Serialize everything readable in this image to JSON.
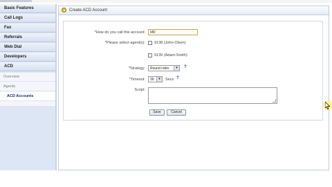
{
  "sidebar": {
    "items": [
      {
        "label": "Basic Features"
      },
      {
        "label": "Call Logs"
      },
      {
        "label": "Fax"
      },
      {
        "label": "Referrals"
      },
      {
        "label": "Web Dial"
      },
      {
        "label": "Developers"
      },
      {
        "label": "ACD"
      }
    ],
    "submenu": [
      {
        "label": "Overview"
      },
      {
        "label": "Agents"
      },
      {
        "label": "ACD Accounts"
      }
    ]
  },
  "panel": {
    "title": "Create ACD Account",
    "form": {
      "account_name_label": "*How do you call this account:",
      "account_name_value": "MR",
      "agents_label": "*Please select agent(s):",
      "agents": [
        {
          "label": "9138 (John-Olsen)",
          "checked": false
        },
        {
          "label": "9139 (Adam-Smith)",
          "checked": false
        }
      ],
      "strategy_label": "*Strategy:",
      "strategy_value": "Round robin",
      "timeout_label": "*Timeout:",
      "timeout_value": "30",
      "timeout_unit": "Secs",
      "script_label": "Script:",
      "help_mark": "?",
      "save_label": "Save",
      "cancel_label": "Cancel"
    }
  },
  "icons": {
    "panel_logo": "app-logo-icon",
    "help": "help-icon",
    "dropdown": "chevron-down-icon",
    "cursor": "mouse-cursor-icon"
  },
  "colors": {
    "sidebar_bg": "#dde6f4",
    "active_link": "#1a2a6c",
    "cursor_highlight": "#fff578"
  }
}
